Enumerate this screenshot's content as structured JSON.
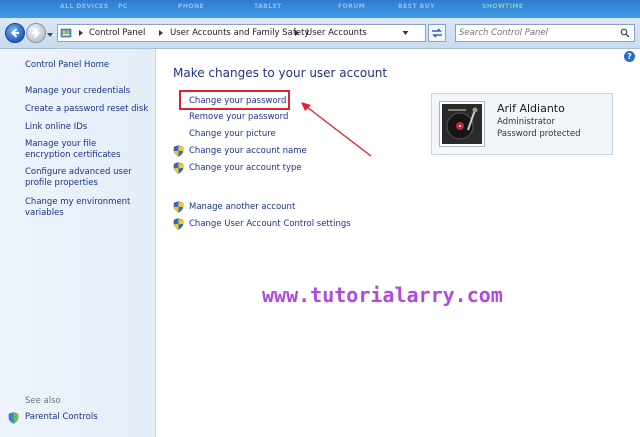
{
  "colors": {
    "link": "#1e3287",
    "highlight": "#e0232e",
    "watermark": "#b048e2",
    "nav_gradient": "#c9dbef",
    "sidebar_bg": "#eef4fb"
  },
  "top_strip": [
    "ALL DEVICES",
    "PC",
    "PHONE",
    "TABLET",
    "FORUM",
    "BEST BUY",
    "SHOWTIME"
  ],
  "breadcrumb": [
    "Control Panel",
    "User Accounts and Family Safety",
    "User Accounts"
  ],
  "search": {
    "placeholder": "Search Control Panel"
  },
  "help_label": "?",
  "sidebar": {
    "home": "Control Panel Home",
    "links": [
      "Manage your credentials",
      "Create a password reset disk",
      "Link online IDs",
      "Manage your file encryption certificates",
      "Configure advanced user profile properties",
      "Change my environment variables"
    ],
    "see_also": "See also",
    "parental_controls": "Parental Controls"
  },
  "main": {
    "title": "Make changes to your user account",
    "tasks": [
      {
        "label": "Change your password",
        "icon": "none"
      },
      {
        "label": "Remove your password",
        "icon": "none"
      },
      {
        "label": "Change your picture",
        "icon": "none"
      },
      {
        "label": "Change your account name",
        "icon": "shield-icon"
      },
      {
        "label": "Change your account type",
        "icon": "shield-icon"
      }
    ],
    "other_tasks": [
      {
        "label": "Manage another account",
        "icon": "shield-icon"
      },
      {
        "label": "Change User Account Control settings",
        "icon": "shield-icon"
      }
    ]
  },
  "user": {
    "name": "Arif Aldianto",
    "role": "Administrator",
    "status": "Password protected"
  },
  "watermark": "www.tutorialarry.com"
}
